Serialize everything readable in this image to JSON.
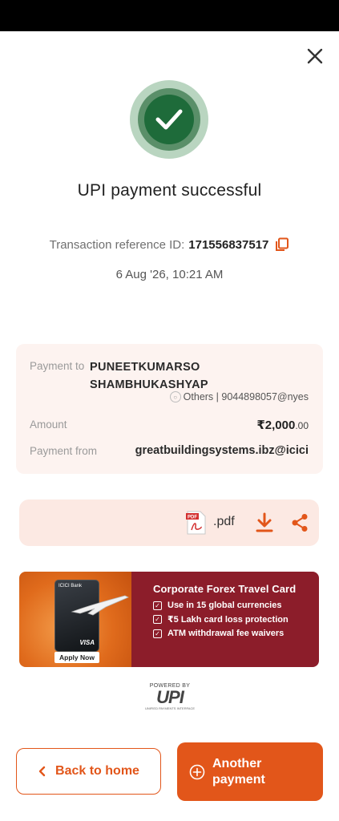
{
  "status_bar": {},
  "header": {
    "close_icon": "close-icon"
  },
  "status": {
    "icon": "check-circle-icon",
    "title": "UPI payment successful"
  },
  "transaction": {
    "ref_label": "Transaction reference ID:",
    "ref_id": "171556837517",
    "copy_icon": "copy-icon",
    "datetime": "6 Aug '26, 10:21 AM"
  },
  "details": {
    "payment_to_label": "Payment to",
    "payee_name_line1": "PUNEETKUMARSO",
    "payee_name_line2": "SHAMBHUKASHYAP",
    "payee_meta": "Others | 9044898057@nyes",
    "amount_label": "Amount",
    "amount_main": "₹2,000",
    "amount_decimal": ".00",
    "payment_from_label": "Payment from",
    "payment_from_value": "greatbuildingsystems.ibz@icici"
  },
  "receipt": {
    "file_label": ".pdf",
    "pdf_icon": "pdf-icon",
    "download_icon": "download-icon",
    "share_icon": "share-icon"
  },
  "promo": {
    "bank_label": "ICICI Bank",
    "card_brand": "VISA",
    "apply_label": "Apply Now",
    "title": "Corporate Forex Travel Card",
    "items": [
      "Use in 15 global currencies",
      "₹5 Lakh card loss protection",
      "ATM withdrawal fee waivers"
    ]
  },
  "upi_logo": {
    "powered_by": "POWERED BY",
    "mark": "UPI",
    "tagline": "UNIFIED PAYMENTS INTERFACE"
  },
  "actions": {
    "back_label": "Back to home",
    "another_label": "Another payment"
  },
  "colors": {
    "accent": "#e2561a",
    "success": "#1e6b3a",
    "card_bg": "#fdf3f0",
    "promo_bg": "#8c1d2a"
  }
}
